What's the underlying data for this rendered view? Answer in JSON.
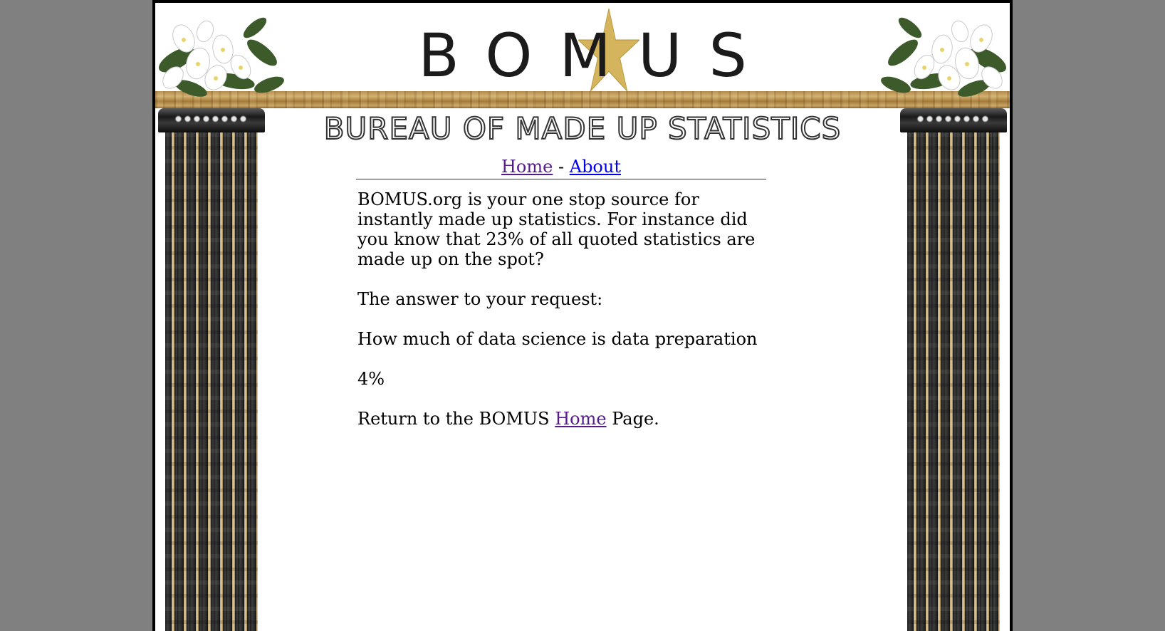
{
  "header": {
    "logo_text": "BOMUS",
    "subtitle": "BUREAU OF MADE UP STATISTICS"
  },
  "nav": {
    "home_label": "Home",
    "separator": "-",
    "about_label": "About"
  },
  "main": {
    "intro": "BOMUS.org is your one stop source for instantly made up statistics. For instance did you know that 23% of all quoted statistics are made up on the spot?",
    "answer_heading": "The answer to your request:",
    "question": "How much of data science is data preparation",
    "answer": "4%",
    "return_prefix": "Return to the BOMUS",
    "return_link": "Home",
    "return_suffix": "Page."
  },
  "colors": {
    "page_background": "#808080",
    "panel_background": "#ffffff",
    "link_visited": "#551a8b",
    "link_unvisited": "#0000ee",
    "star_gold": "#d4b45c",
    "beam_wood": "#c9a566"
  },
  "icons": {
    "star": "star-icon",
    "flowers": "white-lily-bouquet-icon",
    "columns": "marble-column-icon"
  }
}
